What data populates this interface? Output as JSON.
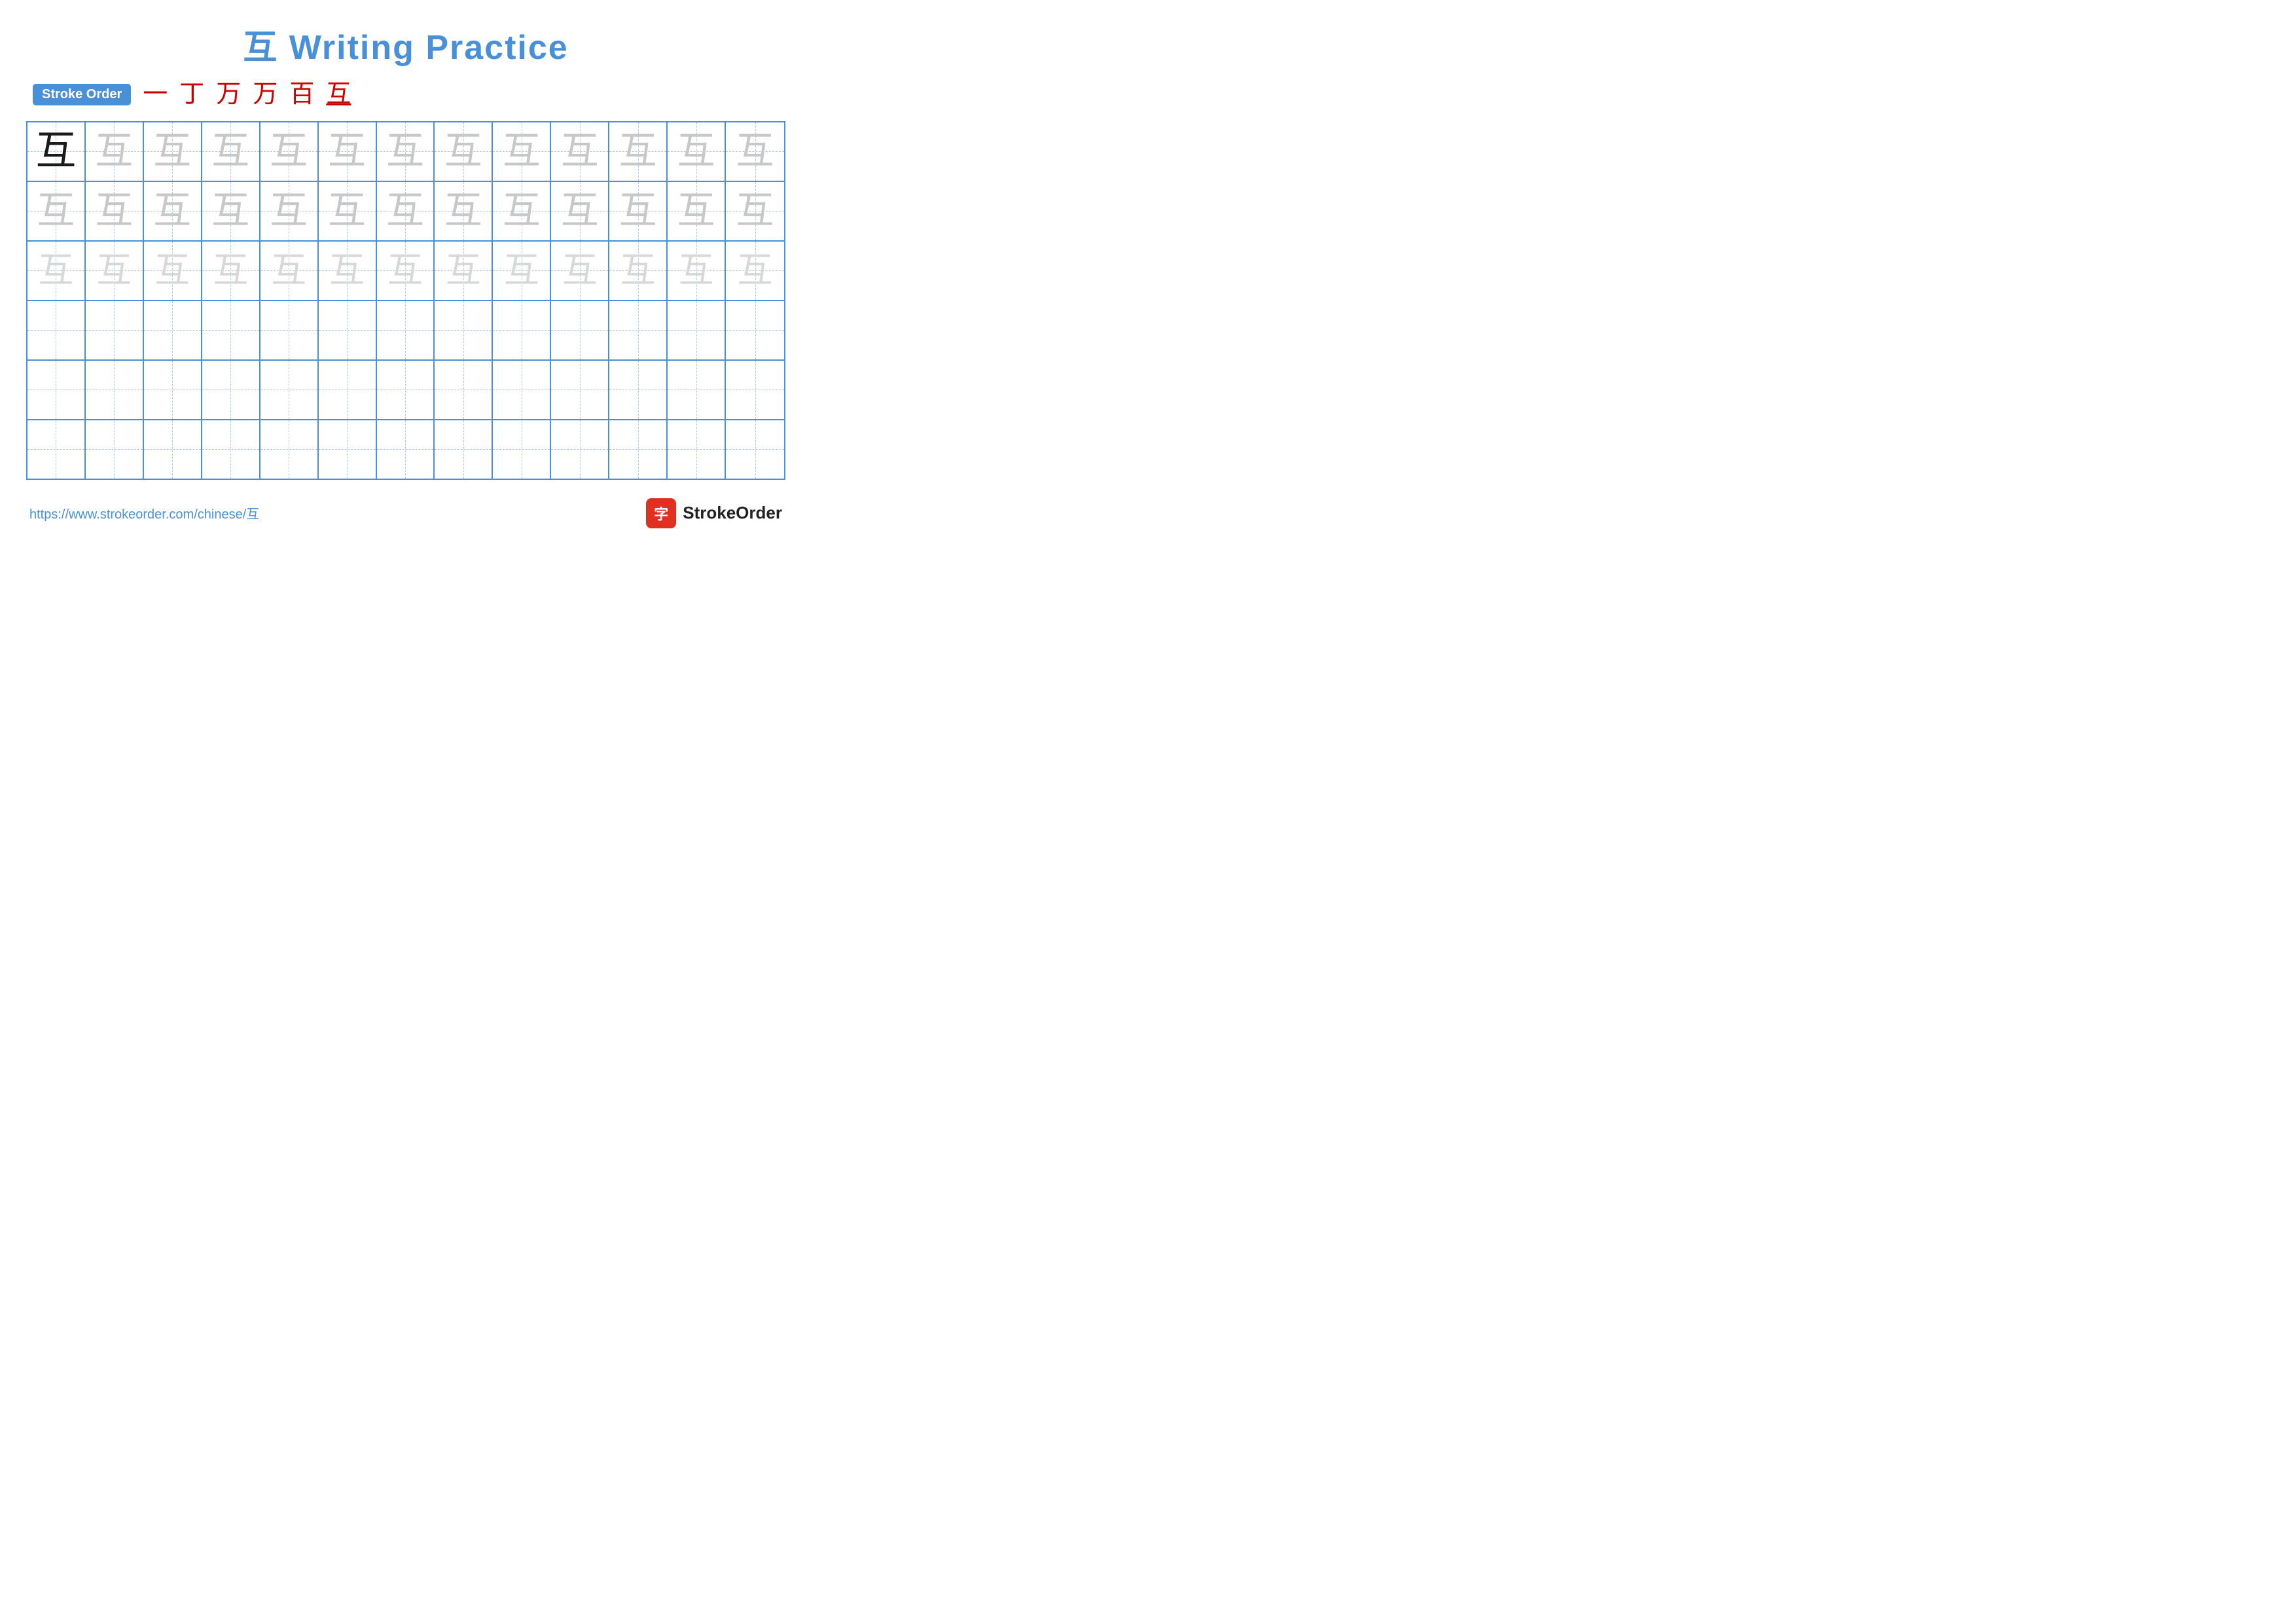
{
  "title": {
    "text": "互 Writing Practice",
    "color": "#4a90d9"
  },
  "stroke_order": {
    "badge_label": "Stroke Order",
    "strokes": [
      "一",
      "丁",
      "万",
      "万",
      "百",
      "互"
    ]
  },
  "grid": {
    "rows": 6,
    "cols": 13,
    "character": "互",
    "row_types": [
      "dark_then_light",
      "light",
      "lighter",
      "empty",
      "empty",
      "empty"
    ]
  },
  "footer": {
    "url": "https://www.strokeorder.com/chinese/互",
    "brand_icon_char": "字",
    "brand_name": "StrokeOrder"
  }
}
